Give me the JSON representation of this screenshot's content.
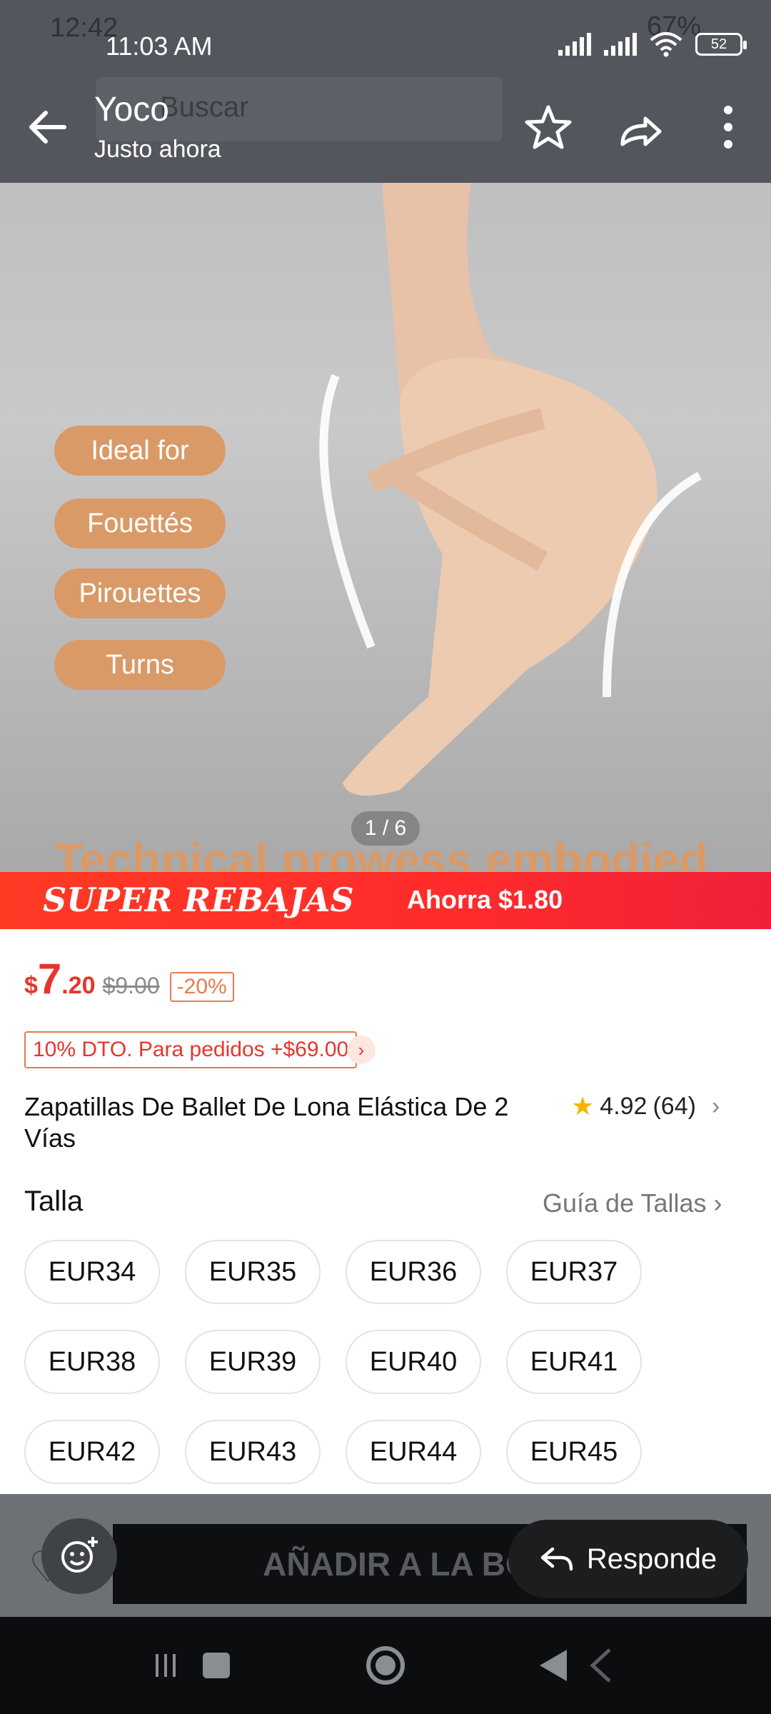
{
  "status_bar": {
    "time": "11:03 AM",
    "ghost_time": "12:42",
    "ghost_battery": "67%",
    "battery": "52"
  },
  "chat_header": {
    "title": "Yoco",
    "subtitle": "Justo ahora",
    "icons": [
      "back-arrow-icon",
      "star-outline-icon",
      "forward-share-icon",
      "more-vert-icon"
    ]
  },
  "underlying_app": {
    "search_placeholder": "Buscar"
  },
  "product_image": {
    "pills": [
      "Ideal for",
      "Fouettés",
      "Pirouettes",
      "Turns"
    ],
    "pager": "1 / 6",
    "caption": "Technical prowess embodied"
  },
  "sale_banner": {
    "title": "SUPER REBAJAS",
    "savings": "Ahorra $1.80"
  },
  "price": {
    "currency": "$",
    "integer": "7",
    "decimal": ".20",
    "original": "$9.00",
    "discount": "-20%"
  },
  "coupon": {
    "label": "10% DTO. Para pedidos +$69.00",
    "arrow": "›"
  },
  "product": {
    "title": "Zapatillas De Ballet De Lona Elástica De 2 Vías",
    "rating": "4.92",
    "reviews": "(64)"
  },
  "size_section": {
    "label": "Talla",
    "guide": "Guía de Tallas",
    "sizes": [
      "EUR34",
      "EUR35",
      "EUR36",
      "EUR37",
      "EUR38",
      "EUR39",
      "EUR40",
      "EUR41",
      "EUR42",
      "EUR43",
      "EUR44",
      "EUR45"
    ]
  },
  "bottom": {
    "add_to_bag": "AÑADIR A LA BOLSA",
    "reply": "Responde"
  },
  "colors": {
    "accent_red": "#e6362c",
    "pill_orange": "#d99a68",
    "overlay_gray": "#53575d"
  }
}
